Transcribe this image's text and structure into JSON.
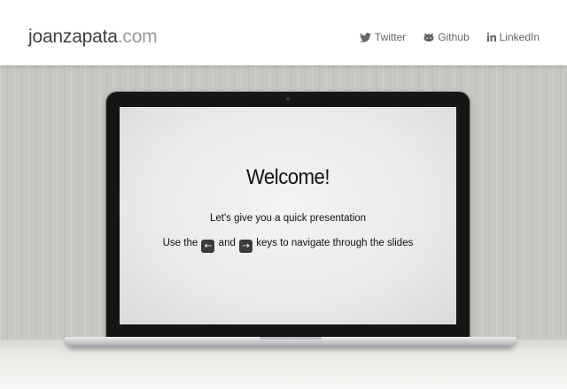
{
  "header": {
    "logo_name": "joanzapata",
    "logo_tld": ".com",
    "nav": [
      {
        "label": "Twitter",
        "icon": "twitter-icon"
      },
      {
        "label": "Github",
        "icon": "github-icon"
      },
      {
        "label": "LinkedIn",
        "icon": "linkedin-icon"
      }
    ]
  },
  "slide": {
    "title": "Welcome!",
    "subtitle": "Let's give you a quick presentation",
    "instr_prefix": "Use the",
    "key_left": "←",
    "instr_and": "and",
    "key_right": "→",
    "instr_suffix": "keys to navigate through the slides"
  },
  "colors": {
    "text_dark": "#3f3f3f",
    "text_muted": "#9a9a9a",
    "nav_text": "#666666",
    "wallpaper": "#c7c6c0",
    "key_bg": "#3b3b3b"
  }
}
